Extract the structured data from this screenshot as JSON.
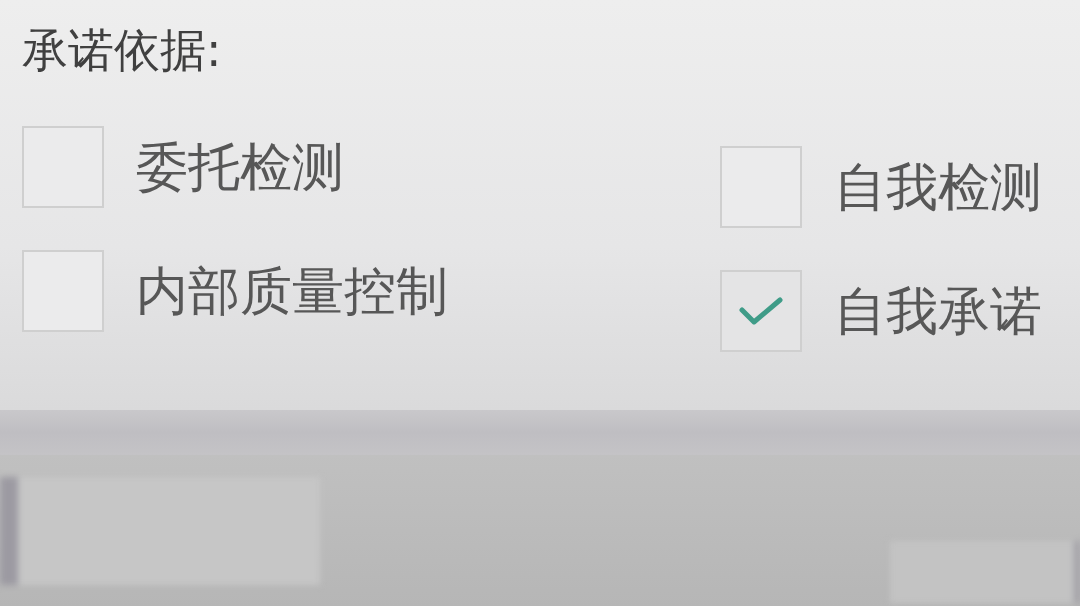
{
  "section": {
    "title": "承诺依据:",
    "columns": [
      {
        "options": [
          {
            "label": "委托检测",
            "checked": false
          },
          {
            "label": "内部质量控制",
            "checked": false
          }
        ]
      },
      {
        "options": [
          {
            "label": "自我检测",
            "checked": false
          },
          {
            "label": "自我承诺",
            "checked": true
          }
        ]
      }
    ]
  }
}
